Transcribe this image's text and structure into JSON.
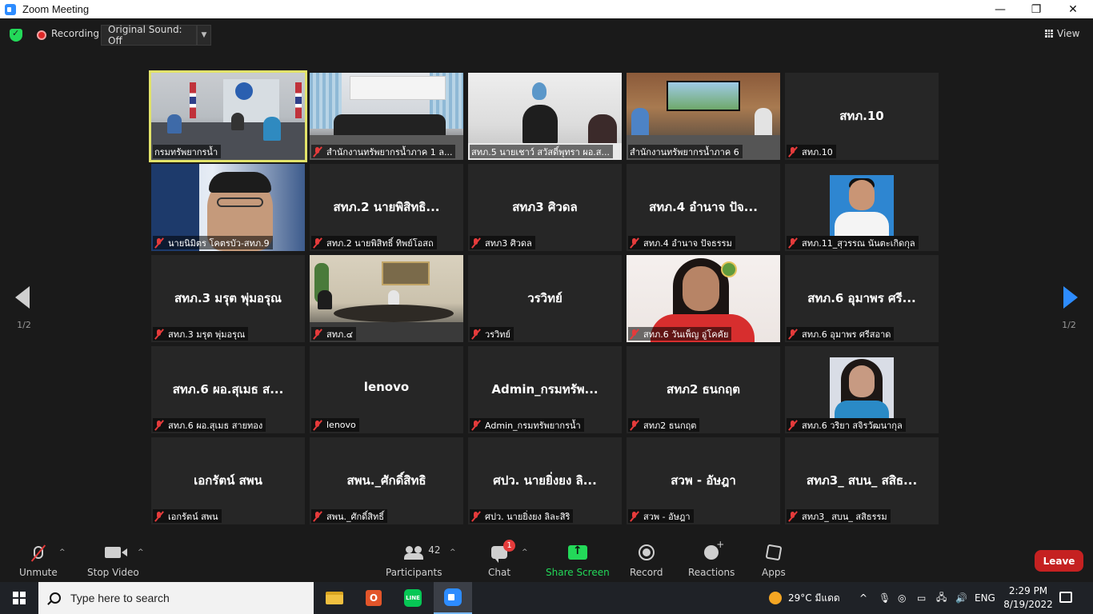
{
  "window": {
    "title": "Zoom Meeting",
    "minimize": "—",
    "restore": "❐",
    "close": "✕"
  },
  "topbar": {
    "recording_label": "Recording",
    "original_sound": "Original Sound: Off",
    "view_label": "View"
  },
  "pagination": {
    "left": "1/2",
    "right": "1/2"
  },
  "tiles": [
    {
      "big": "",
      "label": "กรมทรัพยากรน้ำ",
      "muted": false,
      "scene": "office",
      "active": true
    },
    {
      "big": "",
      "label": "สำนักงานทรัพยากรน้ำภาค 1 ล...",
      "muted": true,
      "scene": "meet1"
    },
    {
      "big": "",
      "label": "สทภ.5 นายเชาว์ สวัสดิ์พุทรา ผอ.ส...",
      "muted": false,
      "scene": "meet2"
    },
    {
      "big": "",
      "label": "สำนักงานทรัพยากรน้ำภาค 6",
      "muted": false,
      "scene": "meet3"
    },
    {
      "big": "สทภ.10",
      "label": "สทภ.10",
      "muted": true,
      "scene": "none"
    },
    {
      "big": "",
      "label": "นายนิมิตร โคตรบัว-สทภ.9",
      "muted": true,
      "scene": "man"
    },
    {
      "big": "สทภ.2 นายพิสิทธิ...",
      "label": "สทภ.2 นายพิสิทธิ์ ทิพย์โอสถ",
      "muted": true,
      "scene": "none"
    },
    {
      "big": "สทภ3 ศิวดล",
      "label": "สทภ3 ศิวดล",
      "muted": true,
      "scene": "none"
    },
    {
      "big": "สทภ.4 อำนาจ ปัจ...",
      "label": "สทภ.4 อำนาจ ปัจธรรม",
      "muted": true,
      "scene": "none"
    },
    {
      "big": "",
      "label": "สทภ.11_สุวรรณ นันตะเกิดกุล",
      "muted": true,
      "scene": "avatar-officer"
    },
    {
      "big": "สทภ.3 มรุต พุ่มอรุณ",
      "label": "สทภ.3 มรุต พุ่มอรุณ",
      "muted": true,
      "scene": "none"
    },
    {
      "big": "",
      "label": "สทภ.๔",
      "muted": true,
      "scene": "room4"
    },
    {
      "big": "วรวิทย์",
      "label": "วรวิทย์",
      "muted": true,
      "scene": "none"
    },
    {
      "big": "",
      "label": "สทภ.6 วันเพ็ญ อู่โคคัย",
      "muted": true,
      "scene": "woman"
    },
    {
      "big": "สทภ.6 อุมาพร ศรี...",
      "label": "สทภ.6 อุมาพร ศรีสอาด",
      "muted": true,
      "scene": "none"
    },
    {
      "big": "สทภ.6 ผอ.สุเมธ ส...",
      "label": "สทภ.6 ผอ.สุเมธ สายทอง",
      "muted": true,
      "scene": "none"
    },
    {
      "big": "lenovo",
      "label": "lenovo",
      "muted": true,
      "scene": "none"
    },
    {
      "big": "Admin_กรมทรัพ...",
      "label": "Admin_กรมทรัพยากรน้ำ",
      "muted": true,
      "scene": "none"
    },
    {
      "big": "สทภ2 ธนกฤต",
      "label": "สทภ2 ธนกฤต",
      "muted": true,
      "scene": "none"
    },
    {
      "big": "",
      "label": "สทภ.6 วริยา สจิรวัฒนากุล",
      "muted": true,
      "scene": "avatar-lady"
    },
    {
      "big": "เอกรัตน์ สพน",
      "label": "เอกรัตน์ สพน",
      "muted": true,
      "scene": "none"
    },
    {
      "big": "สพน._ศักดิ์สิทธิ",
      "label": "สพน._ศักดิ์สิทธิ์",
      "muted": true,
      "scene": "none"
    },
    {
      "big": "ศปว. นายยิ่งยง ลิ...",
      "label": "ศปว. นายยิ่งยง ลิละสิริ",
      "muted": true,
      "scene": "none"
    },
    {
      "big": "สวพ - อัษฎา",
      "label": "สวพ - อัษฎา",
      "muted": true,
      "scene": "none"
    },
    {
      "big": "สทภ3_ สบน_ สสิธ...",
      "label": "สทภ3_ สบน_ สสิธรรม",
      "muted": true,
      "scene": "none"
    }
  ],
  "toolbar": {
    "unmute": "Unmute",
    "stop_video": "Stop Video",
    "participants": "Participants",
    "participants_count": "42",
    "chat": "Chat",
    "chat_badge": "1",
    "share_screen": "Share Screen",
    "record": "Record",
    "reactions": "Reactions",
    "apps": "Apps",
    "leave": "Leave",
    "caret": "^"
  },
  "colors": {
    "accent": "#2d8cff",
    "share_green": "#23d959",
    "leave_red": "#c52121",
    "active_speaker": "#e2e36a",
    "mute_red": "#e53b3b"
  },
  "taskbar": {
    "search_placeholder": "Type here to search",
    "office_letter": "O",
    "line_label": "LINE",
    "weather": "29°C มีแดด",
    "tray_arrow": "^",
    "language": "ENG",
    "time": "2:29 PM",
    "date": "8/19/2022"
  }
}
